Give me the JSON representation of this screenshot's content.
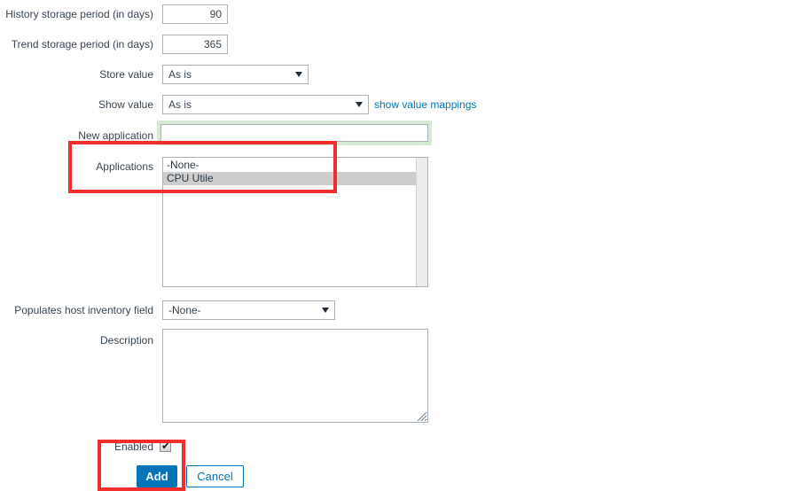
{
  "form": {
    "fields": {
      "history_storage": {
        "label": "History storage period (in days)",
        "value": "90"
      },
      "trend_storage": {
        "label": "Trend storage period (in days)",
        "value": "365"
      },
      "store_value": {
        "label": "Store value",
        "value": "As is"
      },
      "show_value": {
        "label": "Show value",
        "value": "As is",
        "link_text": "show value mappings"
      },
      "new_application": {
        "label": "New application",
        "value": "",
        "placeholder": ""
      },
      "applications": {
        "label": "Applications",
        "options": [
          {
            "text": "-None-",
            "selected": false
          },
          {
            "text": "CPU Utile",
            "selected": true
          }
        ]
      },
      "host_inventory": {
        "label": "Populates host inventory field",
        "value": "-None-"
      },
      "description": {
        "label": "Description",
        "value": "",
        "placeholder": ""
      },
      "enabled": {
        "label": "Enabled",
        "checked": true,
        "check_glyph": "✔"
      }
    },
    "buttons": {
      "add": "Add",
      "cancel": "Cancel"
    }
  },
  "annotations": {
    "highlight_color": "#f22d2d",
    "boxes": [
      {
        "name": "applications-highlight"
      },
      {
        "name": "add-button-highlight"
      }
    ]
  },
  "colors": {
    "accent_blue": "#0275b8",
    "label_text": "#3a4653",
    "input_border": "#a8b2bb",
    "focus_glow_green": "#d6e9d4",
    "selected_option_bg": "#cdcdcd",
    "annotation_red": "#f22d2d"
  }
}
